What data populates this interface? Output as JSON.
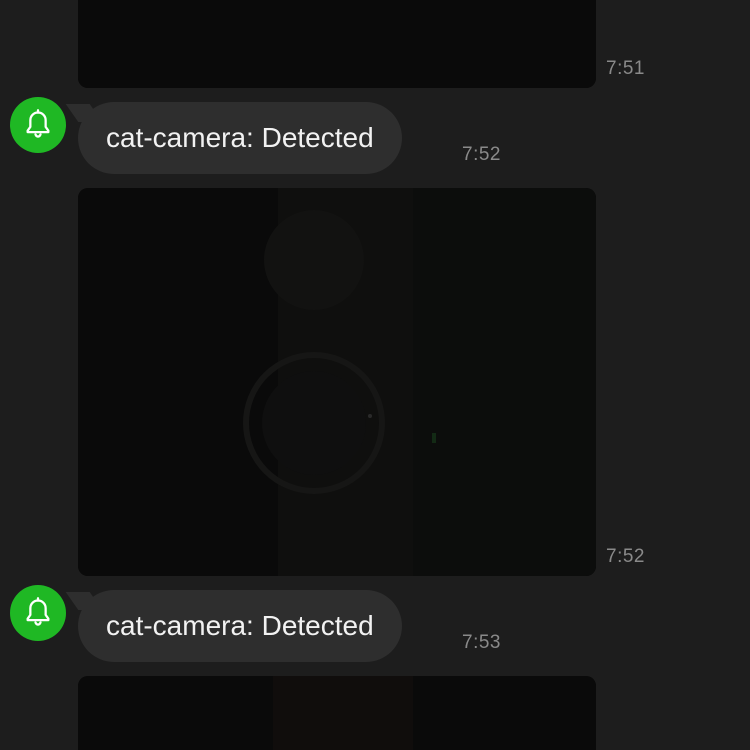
{
  "messages": [
    {
      "type": "image",
      "time": "7:51"
    },
    {
      "type": "notification",
      "sender_icon": "bell-icon",
      "text": "cat-camera: Detected",
      "time": "7:52"
    },
    {
      "type": "image",
      "time": "7:52"
    },
    {
      "type": "notification",
      "sender_icon": "bell-icon",
      "text": "cat-camera: Detected",
      "time": "7:53"
    },
    {
      "type": "image",
      "time": ""
    }
  ],
  "colors": {
    "background": "#1d1d1d",
    "bubble": "#2e2e2e",
    "avatar": "#1fb824",
    "timestamp": "#8a8a8a",
    "text": "#f2f2f2"
  }
}
